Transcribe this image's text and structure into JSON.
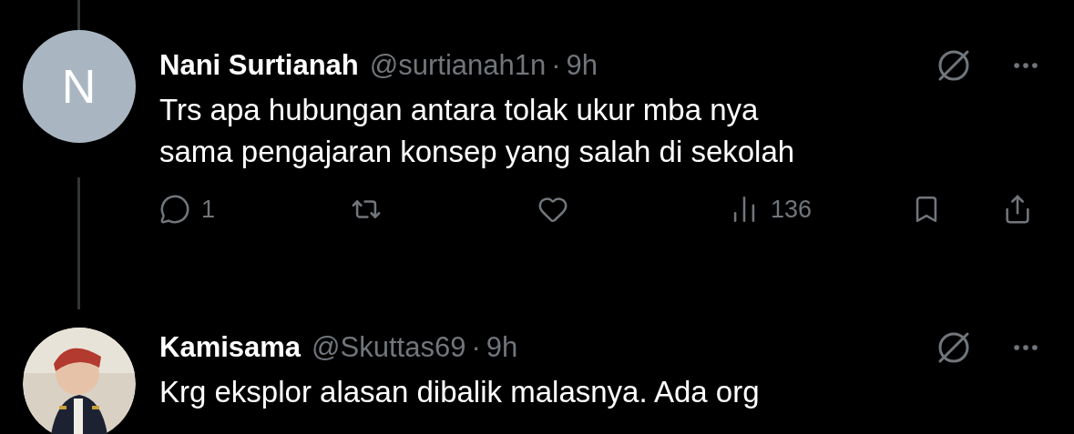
{
  "tweets": [
    {
      "avatar": {
        "kind": "letter",
        "letter": "N"
      },
      "thread_line_above": true,
      "thread_line_below": true,
      "name": "Nani Surtianah",
      "handle": "@surtianah1n",
      "separator": "·",
      "time": "9h",
      "lines": [
        "Trs apa hubungan antara tolak ukur mba nya",
        "sama pengajaran konsep yang salah di sekolah"
      ],
      "actions": [
        {
          "kind": "reply",
          "count": "1"
        },
        {
          "kind": "repost"
        },
        {
          "kind": "like"
        },
        {
          "kind": "views",
          "count": "136"
        },
        {
          "kind": "bookmark"
        },
        {
          "kind": "share"
        }
      ]
    },
    {
      "avatar": {
        "kind": "picture"
      },
      "name": "Kamisama",
      "handle": "@Skuttas69",
      "separator": "·",
      "time": "9h",
      "lines": [
        "Krg eksplor alasan dibalik malasnya. Ada org"
      ]
    }
  ]
}
